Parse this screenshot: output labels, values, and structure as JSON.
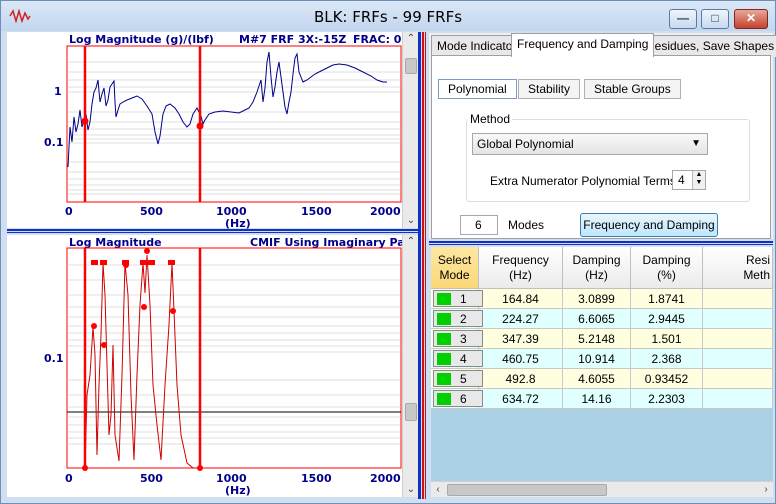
{
  "window": {
    "title": "BLK: FRFs - 99 FRFs",
    "minimize_glyph": "—",
    "maximize_glyph": "□",
    "close_glyph": "✕"
  },
  "top_plot": {
    "caption_left": "Log Magnitude (g)/(lbf)",
    "caption_mid": "M#7 FRF 3X:-15Z",
    "caption_right": "FRAC: 0",
    "y_ticks": [
      "1",
      "0.1"
    ],
    "x_ticks": [
      "0",
      "500",
      "1000",
      "1500",
      "2000"
    ],
    "x_unit": "(Hz)"
  },
  "bottom_plot": {
    "caption_left": "Log Magnitude",
    "caption_right": "CMIF Using Imaginary Part",
    "y_ticks": [
      "0.1"
    ],
    "x_ticks": [
      "0",
      "500",
      "1000",
      "1500",
      "2000"
    ],
    "x_unit": "(Hz)"
  },
  "tabs": [
    "Mode Indicator",
    "Frequency and Damping",
    "Residues, Save Shapes"
  ],
  "active_tab": "Frequency and Damping",
  "subtabs": [
    "Polynomial",
    "Stability",
    "Stable Groups"
  ],
  "method": {
    "group_label": "Method",
    "selected": "Global Polynomial",
    "extra_terms_label": "Extra Numerator Polynomial Terms",
    "extra_terms_value": "4"
  },
  "modes": {
    "value": "6",
    "label": "Modes",
    "button_label": "Frequency and Damping"
  },
  "table": {
    "columns": [
      "Select Mode",
      "Frequency (Hz)",
      "Damping (Hz)",
      "Damping (%)",
      "Resi Meth"
    ],
    "rows": [
      {
        "mode": "1",
        "freq": "164.84",
        "damp_hz": "3.0899",
        "damp_pct": "1.8741"
      },
      {
        "mode": "2",
        "freq": "224.27",
        "damp_hz": "6.6065",
        "damp_pct": "2.9445"
      },
      {
        "mode": "3",
        "freq": "347.39",
        "damp_hz": "5.2148",
        "damp_pct": "1.501"
      },
      {
        "mode": "4",
        "freq": "460.75",
        "damp_hz": "10.914",
        "damp_pct": "2.368"
      },
      {
        "mode": "5",
        "freq": "492.8",
        "damp_hz": "4.6055",
        "damp_pct": "0.93452"
      },
      {
        "mode": "6",
        "freq": "634.72",
        "damp_hz": "14.16",
        "damp_pct": "2.2303"
      }
    ],
    "row_colors": [
      "#ffffe0",
      "#e0ffff"
    ],
    "select_color": "#00d000"
  },
  "colors": {
    "plot_frame": "#ff0000",
    "frf_line": "#00008b",
    "cmif_line": "#d00000",
    "separator": "#1030c0"
  }
}
